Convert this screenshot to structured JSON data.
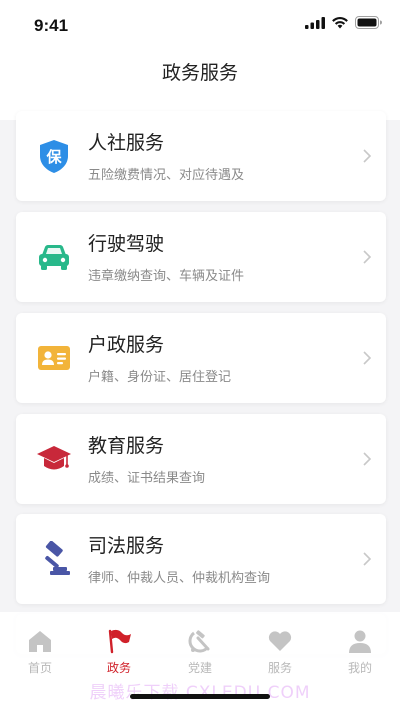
{
  "status_bar": {
    "time": "9:41"
  },
  "header": {
    "title": "政务服务"
  },
  "services": [
    {
      "title": "人社服务",
      "subtitle": "五险缴费情况、对应待遇及",
      "icon": "shield-bao-icon",
      "color": "#2d8ee6"
    },
    {
      "title": "行驶驾驶",
      "subtitle": "违章缴纳查询、车辆及证件",
      "icon": "car-icon",
      "color": "#28b88a"
    },
    {
      "title": "户政服务",
      "subtitle": "户籍、身份证、居住登记",
      "icon": "id-card-icon",
      "color": "#f2b43a"
    },
    {
      "title": "教育服务",
      "subtitle": "成绩、证书结果查询",
      "icon": "graduation-cap-icon",
      "color": "#c8283a"
    },
    {
      "title": "司法服务",
      "subtitle": "律师、仲裁人员、仲裁机构查询",
      "icon": "gavel-icon",
      "color": "#4a56a6"
    }
  ],
  "tabbar": {
    "items": [
      {
        "label": "首页",
        "icon": "home-icon",
        "active": false
      },
      {
        "label": "政务",
        "icon": "flag-icon",
        "active": true
      },
      {
        "label": "党建",
        "icon": "hammer-sickle-icon",
        "active": false
      },
      {
        "label": "服务",
        "icon": "heart-icon",
        "active": false
      },
      {
        "label": "我的",
        "icon": "user-icon",
        "active": false
      }
    ],
    "active_color": "#d0212a",
    "inactive_color": "#b8b8b8"
  },
  "watermark": "晨曦乐下载  CXLEDU.COM"
}
